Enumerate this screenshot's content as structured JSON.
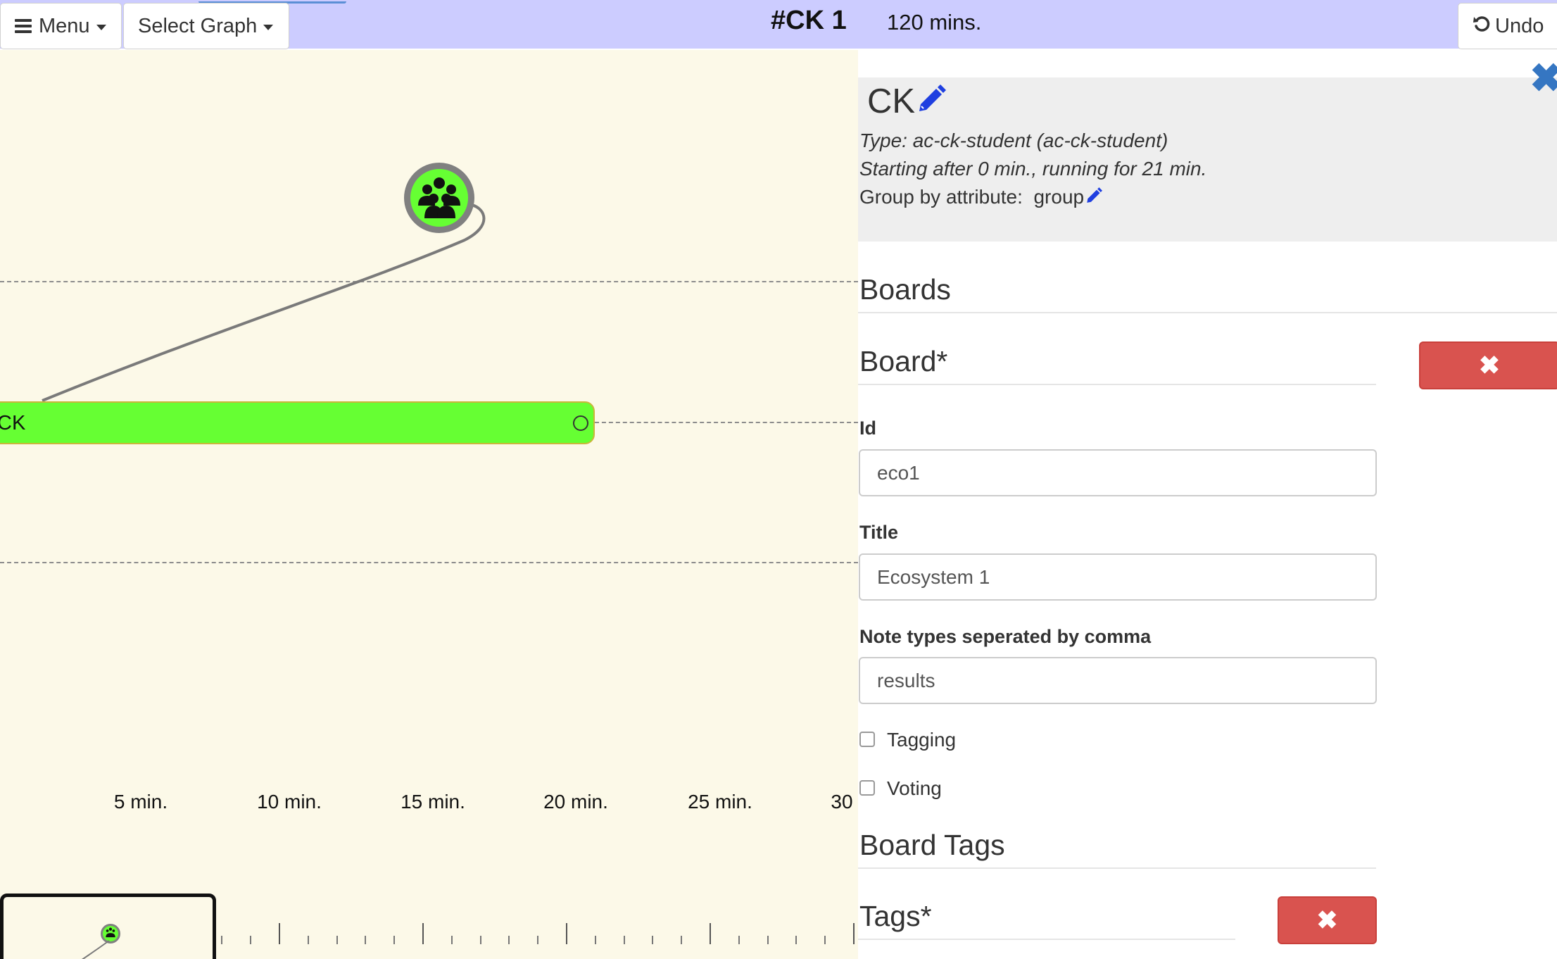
{
  "toolbar": {
    "menu_label": "Menu",
    "select_graph_label": "Select Graph",
    "graph_title": "#CK 1",
    "duration": "120 mins.",
    "undo_label": "Undo"
  },
  "canvas": {
    "activity_label": "CK",
    "operator_icon": "users-group-icon",
    "timeline_ticks": [
      "5 min.",
      "10 min.",
      "15 min.",
      "20 min.",
      "25 min.",
      "30"
    ],
    "colors": {
      "background": "#fcf9e8",
      "activity": "#66ff33",
      "node_ring": "#808080"
    }
  },
  "panel": {
    "activity_name": "CK",
    "type_text": "Type: ac-ck-student (ac-ck-student)",
    "timing_text": "Starting after 0 min., running for 21 min.",
    "group_by_prefix": "Group by attribute:",
    "group_by_value": "group",
    "boards_heading": "Boards",
    "board_heading": "Board*",
    "fields": {
      "id_label": "Id",
      "id_value": "eco1",
      "title_label": "Title",
      "title_value": "Ecosystem 1",
      "notes_label": "Note types seperated by comma",
      "notes_value": "results"
    },
    "checkboxes": {
      "tagging_label": "Tagging",
      "voting_label": "Voting"
    },
    "board_tags_heading": "Board Tags",
    "tags_heading": "Tags*",
    "colors": {
      "delete_button": "#d9534f",
      "close_icon": "#3576c2",
      "pencil": "#1f3fe0"
    }
  }
}
